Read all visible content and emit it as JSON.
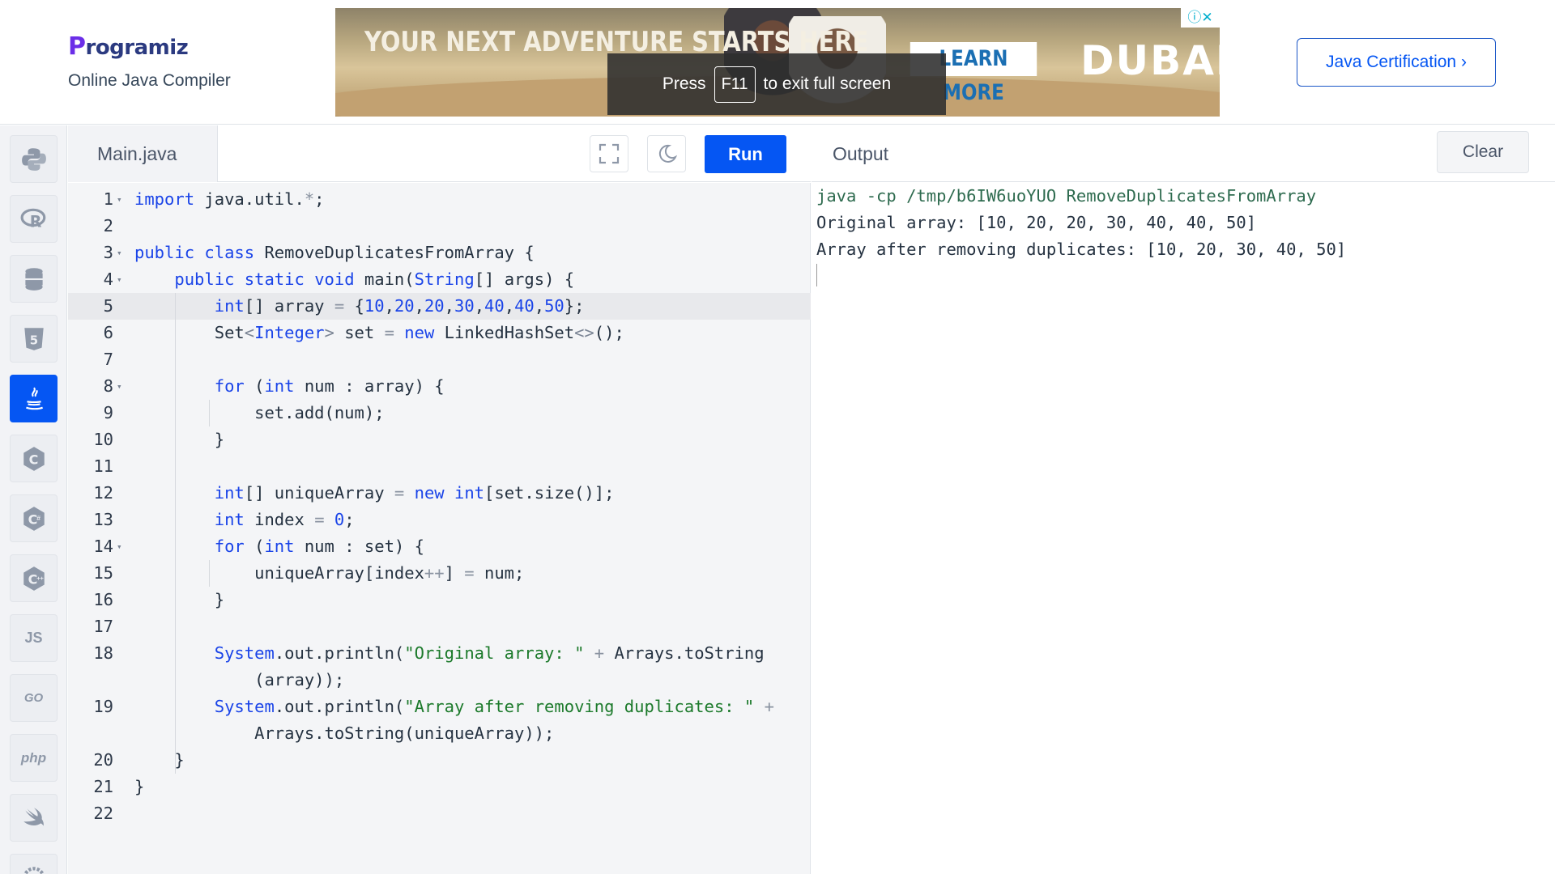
{
  "header": {
    "logo_text": "rogramiz",
    "logo_letter": "P",
    "subtitle": "Online Java Compiler",
    "cert_button": "Java Certification ›"
  },
  "ad": {
    "headline": "YOUR NEXT ADVENTURE STARTS HERE",
    "cta": "LEARN MORE",
    "brand": "DUBAI",
    "close": "ⓘ✕"
  },
  "fullscreen_notice": {
    "before": "Press",
    "key": "F11",
    "after": "to exit full screen"
  },
  "sidebar": {
    "items": [
      {
        "name": "python",
        "label": ""
      },
      {
        "name": "r",
        "label": "R"
      },
      {
        "name": "sql",
        "label": ""
      },
      {
        "name": "html",
        "label": "5"
      },
      {
        "name": "java",
        "label": ""
      },
      {
        "name": "c",
        "label": "C"
      },
      {
        "name": "csharp",
        "label": "C"
      },
      {
        "name": "cpp",
        "label": "C"
      },
      {
        "name": "javascript",
        "label": "JS"
      },
      {
        "name": "go",
        "label": "GO"
      },
      {
        "name": "php",
        "label": "php"
      },
      {
        "name": "swift",
        "label": ""
      },
      {
        "name": "rust",
        "label": ""
      }
    ],
    "active": "java"
  },
  "editor": {
    "tab_label": "Main.java",
    "run_label": "Run",
    "highlighted_line": 5,
    "lines": [
      {
        "n": "1",
        "fold": true
      },
      {
        "n": "2",
        "fold": false
      },
      {
        "n": "3",
        "fold": true
      },
      {
        "n": "4",
        "fold": true
      },
      {
        "n": "5",
        "fold": false
      },
      {
        "n": "6",
        "fold": false
      },
      {
        "n": "7",
        "fold": false
      },
      {
        "n": "8",
        "fold": true
      },
      {
        "n": "9",
        "fold": false
      },
      {
        "n": "10",
        "fold": false
      },
      {
        "n": "11",
        "fold": false
      },
      {
        "n": "12",
        "fold": false
      },
      {
        "n": "13",
        "fold": false
      },
      {
        "n": "14",
        "fold": true
      },
      {
        "n": "15",
        "fold": false
      },
      {
        "n": "16",
        "fold": false
      },
      {
        "n": "17",
        "fold": false
      },
      {
        "n": "18",
        "fold": false
      },
      {
        "n": "",
        "fold": false
      },
      {
        "n": "19",
        "fold": false
      },
      {
        "n": "",
        "fold": false
      },
      {
        "n": "20",
        "fold": false
      },
      {
        "n": "21",
        "fold": false
      },
      {
        "n": "22",
        "fold": false
      }
    ],
    "code": [
      [
        [
          "kw",
          "import"
        ],
        [
          "t",
          " java.util."
        ],
        [
          "op",
          "*"
        ],
        [
          "t",
          ";"
        ]
      ],
      [],
      [
        [
          "kw",
          "public"
        ],
        [
          "t",
          " "
        ],
        [
          "kw",
          "class"
        ],
        [
          "t",
          " RemoveDuplicatesFromArray {"
        ]
      ],
      [
        [
          "t",
          "    "
        ],
        [
          "kw",
          "public"
        ],
        [
          "t",
          " "
        ],
        [
          "kw",
          "static"
        ],
        [
          "t",
          " "
        ],
        [
          "kw",
          "void"
        ],
        [
          "t",
          " main("
        ],
        [
          "cls",
          "String"
        ],
        [
          "t",
          "[] args) {"
        ]
      ],
      [
        [
          "t",
          "        "
        ],
        [
          "kw",
          "int"
        ],
        [
          "t",
          "[] array "
        ],
        [
          "op",
          "="
        ],
        [
          "t",
          " {"
        ],
        [
          "num",
          "10"
        ],
        [
          "t",
          ","
        ],
        [
          "num",
          "20"
        ],
        [
          "t",
          ","
        ],
        [
          "num",
          "20"
        ],
        [
          "t",
          ","
        ],
        [
          "num",
          "30"
        ],
        [
          "t",
          ","
        ],
        [
          "num",
          "40"
        ],
        [
          "t",
          ","
        ],
        [
          "num",
          "40"
        ],
        [
          "t",
          ","
        ],
        [
          "num",
          "50"
        ],
        [
          "t",
          "};"
        ]
      ],
      [
        [
          "t",
          "        Set"
        ],
        [
          "gen",
          "<"
        ],
        [
          "cls",
          "Integer"
        ],
        [
          "gen",
          ">"
        ],
        [
          "t",
          " set "
        ],
        [
          "op",
          "="
        ],
        [
          "t",
          " "
        ],
        [
          "kw",
          "new"
        ],
        [
          "t",
          " LinkedHashSet"
        ],
        [
          "gen",
          "<>"
        ],
        [
          "t",
          "();"
        ]
      ],
      [],
      [
        [
          "t",
          "        "
        ],
        [
          "kw",
          "for"
        ],
        [
          "t",
          " ("
        ],
        [
          "kw",
          "int"
        ],
        [
          "t",
          " num : array) {"
        ]
      ],
      [
        [
          "t",
          "            set.add(num);"
        ]
      ],
      [
        [
          "t",
          "        }"
        ]
      ],
      [],
      [
        [
          "t",
          "        "
        ],
        [
          "kw",
          "int"
        ],
        [
          "t",
          "[] uniqueArray "
        ],
        [
          "op",
          "="
        ],
        [
          "t",
          " "
        ],
        [
          "kw",
          "new"
        ],
        [
          "t",
          " "
        ],
        [
          "kw",
          "int"
        ],
        [
          "t",
          "[set.size()];"
        ]
      ],
      [
        [
          "t",
          "        "
        ],
        [
          "kw",
          "int"
        ],
        [
          "t",
          " index "
        ],
        [
          "op",
          "="
        ],
        [
          "t",
          " "
        ],
        [
          "num",
          "0"
        ],
        [
          "t",
          ";"
        ]
      ],
      [
        [
          "t",
          "        "
        ],
        [
          "kw",
          "for"
        ],
        [
          "t",
          " ("
        ],
        [
          "kw",
          "int"
        ],
        [
          "t",
          " num : set) {"
        ]
      ],
      [
        [
          "t",
          "            uniqueArray[index"
        ],
        [
          "op",
          "++"
        ],
        [
          "t",
          "] "
        ],
        [
          "op",
          "="
        ],
        [
          "t",
          " num;"
        ]
      ],
      [
        [
          "t",
          "        }"
        ]
      ],
      [],
      [
        [
          "t",
          "        "
        ],
        [
          "cls",
          "System"
        ],
        [
          "t",
          ".out.println("
        ],
        [
          "str",
          "\"Original array: \""
        ],
        [
          "t",
          " "
        ],
        [
          "op",
          "+"
        ],
        [
          "t",
          " Arrays.toString"
        ]
      ],
      [
        [
          "t",
          "            (array));"
        ]
      ],
      [
        [
          "t",
          "        "
        ],
        [
          "cls",
          "System"
        ],
        [
          "t",
          ".out.println("
        ],
        [
          "str",
          "\"Array after removing duplicates: \""
        ],
        [
          "t",
          " "
        ],
        [
          "op",
          "+"
        ]
      ],
      [
        [
          "t",
          "            Arrays.toString(uniqueArray));"
        ]
      ],
      [
        [
          "t",
          "    }"
        ]
      ],
      [
        [
          "t",
          "}"
        ]
      ],
      []
    ]
  },
  "output": {
    "title": "Output",
    "clear_label": "Clear",
    "lines": [
      "java -cp /tmp/b6IW6uoYUO RemoveDuplicatesFromArray",
      "Original array: [10, 20, 20, 30, 40, 40, 50]",
      "Array after removing duplicates: [10, 20, 30, 40, 50]"
    ]
  },
  "colors": {
    "accent": "#0556f3",
    "keyword": "#1a44e8",
    "string": "#1c7a2b"
  }
}
